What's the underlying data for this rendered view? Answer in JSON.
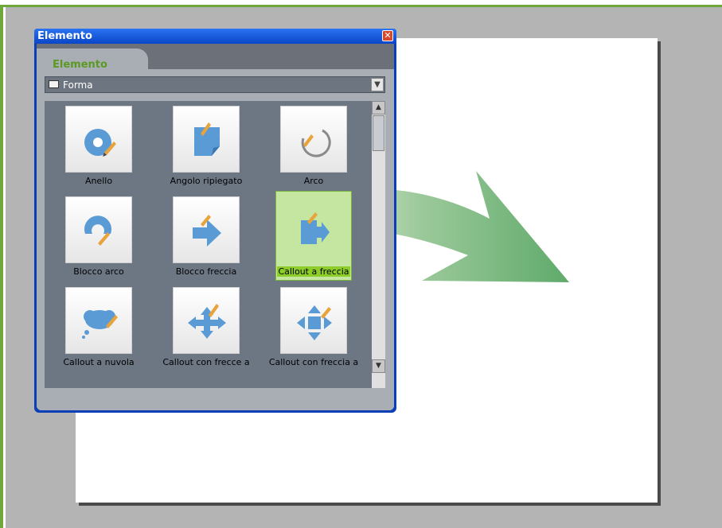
{
  "dialog": {
    "title": "Elemento",
    "tab_label": "Elemento",
    "dropdown_value": "Forma"
  },
  "items": [
    {
      "label": "Anello",
      "icon": "ring-shape-icon"
    },
    {
      "label": "Angolo ripiegato",
      "icon": "folded-corner-icon"
    },
    {
      "label": "Arco",
      "icon": "arc-icon"
    },
    {
      "label": "Blocco arco",
      "icon": "block-arc-icon"
    },
    {
      "label": "Blocco freccia",
      "icon": "block-arrow-icon"
    },
    {
      "label": "Callout a freccia",
      "icon": "arrow-callout-icon",
      "selected": true
    },
    {
      "label": "Callout a nuvola",
      "icon": "cloud-callout-icon"
    },
    {
      "label": "Callout con frecce a",
      "icon": "quad-arrow-callout-icon"
    },
    {
      "label": "Callout con freccia a",
      "icon": "cross-arrow-callout-icon"
    }
  ],
  "colors": {
    "accent_green": "#6ea83a",
    "shape_blue": "#5b9bd5",
    "selection_green": "#8ccd2a"
  }
}
